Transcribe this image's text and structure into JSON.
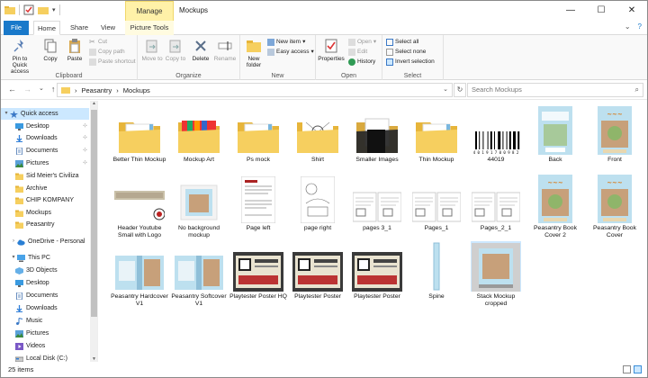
{
  "window": {
    "title": "Mockups",
    "context_tab": "Manage",
    "controls": [
      "—",
      "☐",
      "✕"
    ]
  },
  "tabs": {
    "file": "File",
    "home": "Home",
    "share": "Share",
    "view": "View",
    "picture_tools": "Picture Tools"
  },
  "ribbon": {
    "clipboard": {
      "label": "Clipboard",
      "pin": "Pin to Quick access",
      "copy": "Copy",
      "paste": "Paste",
      "cut": "Cut",
      "copy_path": "Copy path",
      "paste_shortcut": "Paste shortcut"
    },
    "organize": {
      "label": "Organize",
      "move_to": "Move to",
      "copy_to": "Copy to",
      "delete": "Delete",
      "rename": "Rename"
    },
    "new": {
      "label": "New",
      "new_folder": "New folder",
      "new_item": "New item",
      "easy_access": "Easy access"
    },
    "open": {
      "label": "Open",
      "properties": "Properties",
      "open": "Open",
      "edit": "Edit",
      "history": "History"
    },
    "select": {
      "label": "Select",
      "select_all": "Select all",
      "select_none": "Select none",
      "invert": "Invert selection"
    }
  },
  "address": {
    "crumbs": [
      "Peasantry",
      "Mockups"
    ],
    "search_placeholder": "Search Mockups"
  },
  "nav": {
    "items": [
      {
        "label": "Quick access",
        "type": "star",
        "top": 0,
        "sel": true
      },
      {
        "label": "Desktop",
        "type": "desktop",
        "pin": "📌"
      },
      {
        "label": "Downloads",
        "type": "download",
        "pin": "📌"
      },
      {
        "label": "Documents",
        "type": "docs",
        "pin": "📌"
      },
      {
        "label": "Pictures",
        "type": "pics",
        "pin": "📌"
      },
      {
        "label": "Sid Meier's Civiliza",
        "type": "folder"
      },
      {
        "label": "Archive",
        "type": "folder"
      },
      {
        "label": "CHIP KOMPANY",
        "type": "folder"
      },
      {
        "label": "Mockups",
        "type": "folder"
      },
      {
        "label": "Peasantry",
        "type": "folder"
      },
      {
        "label": "OneDrive - Personal",
        "type": "cloud"
      },
      {
        "label": "This PC",
        "type": "pc"
      },
      {
        "label": "3D Objects",
        "type": "cube"
      },
      {
        "label": "Desktop",
        "type": "desktop"
      },
      {
        "label": "Documents",
        "type": "docs"
      },
      {
        "label": "Downloads",
        "type": "download"
      },
      {
        "label": "Music",
        "type": "music"
      },
      {
        "label": "Pictures",
        "type": "pics"
      },
      {
        "label": "Videos",
        "type": "video"
      },
      {
        "label": "Local Disk (C:)",
        "type": "disk"
      }
    ]
  },
  "files": [
    {
      "name": "Better Thin Mockup",
      "kind": "folder-thin"
    },
    {
      "name": "Mockup Art",
      "kind": "folder-art"
    },
    {
      "name": "Ps mock",
      "kind": "folder-thin"
    },
    {
      "name": "Shirt",
      "kind": "folder-shirt"
    },
    {
      "name": "Smaller Images",
      "kind": "folder-dark"
    },
    {
      "name": "Thin Mockup",
      "kind": "folder-thin"
    },
    {
      "name": "44019",
      "kind": "barcode",
      "barcode_text": "4 0 1 9 1 7 0 0 9 8 2"
    },
    {
      "name": "Back",
      "kind": "book-back"
    },
    {
      "name": "Front",
      "kind": "book-front"
    },
    {
      "name": "Header Youtube Small with Logo",
      "kind": "banner"
    },
    {
      "name": "No background mockup",
      "kind": "mockup"
    },
    {
      "name": "Page left",
      "kind": "page"
    },
    {
      "name": "page right",
      "kind": "page-right"
    },
    {
      "name": "pages 3_1",
      "kind": "spread"
    },
    {
      "name": "Pages_1",
      "kind": "spread"
    },
    {
      "name": "Pages_2_1",
      "kind": "spread"
    },
    {
      "name": "Peasantry Book Cover 2",
      "kind": "book-front"
    },
    {
      "name": "Peasantry Book Cover",
      "kind": "book-front"
    },
    {
      "name": "Peasantry Hardcover V1",
      "kind": "hardcover"
    },
    {
      "name": "Peasantry Softcover V1",
      "kind": "hardcover"
    },
    {
      "name": "Playtester Poster HQ",
      "kind": "poster"
    },
    {
      "name": "Playtester Poster",
      "kind": "poster"
    },
    {
      "name": "Playtester Poster",
      "kind": "poster"
    },
    {
      "name": "Spine",
      "kind": "spine"
    },
    {
      "name": "Stack Mockup cropped",
      "kind": "stack"
    }
  ],
  "status": {
    "count": "25 items"
  },
  "colors": {
    "accent": "#1979ca",
    "folder": "#f6cf5f",
    "folder_dark": "#e7b53a",
    "select": "#cce8ff",
    "manage": "#fff1a8"
  }
}
